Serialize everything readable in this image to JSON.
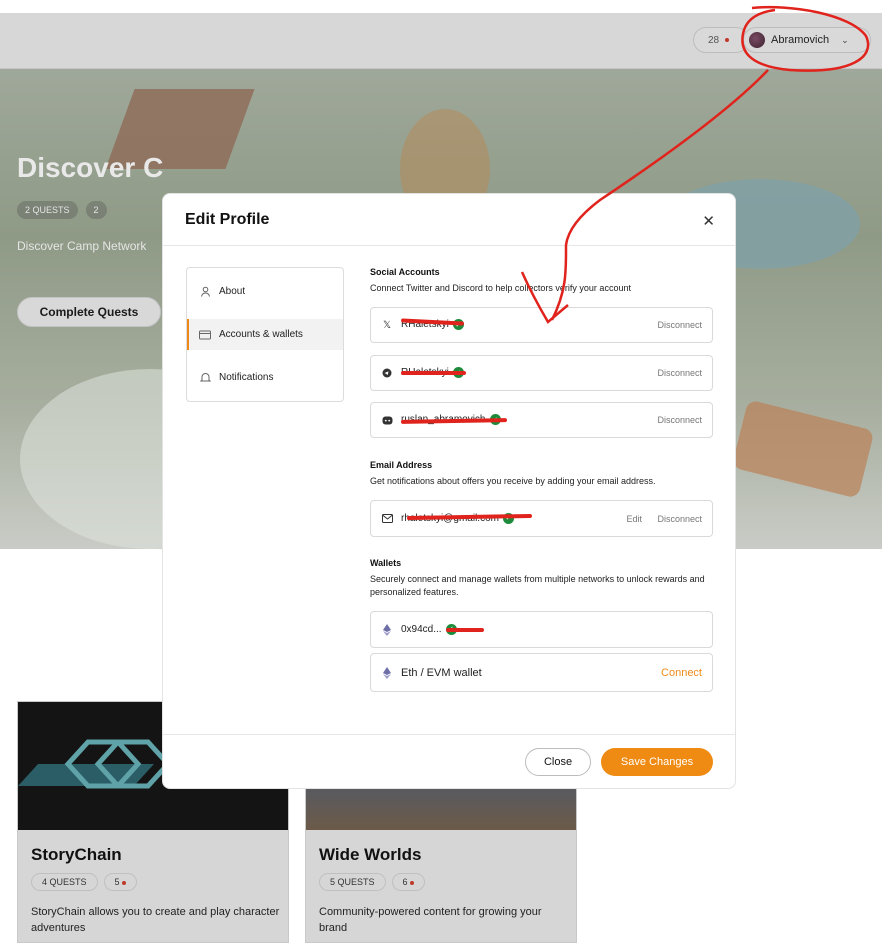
{
  "header": {
    "points": "28",
    "username": "Abramovich"
  },
  "hero": {
    "title": "Discover C",
    "badges": [
      "2 QUESTS",
      "2"
    ],
    "description": "Discover Camp Network",
    "cta": "Complete Quests"
  },
  "cards": [
    {
      "title": "StoryChain",
      "quests": "4 QUESTS",
      "points": "5",
      "description": "StoryChain allows you to create and play character adventures"
    },
    {
      "title": "Wide Worlds",
      "quests": "5 QUESTS",
      "points": "6",
      "description": "Community-powered content for growing your brand"
    }
  ],
  "modal": {
    "title": "Edit Profile",
    "sidebar": [
      {
        "label": "About",
        "icon": "user-icon"
      },
      {
        "label": "Accounts & wallets",
        "icon": "wallet-icon",
        "active": true
      },
      {
        "label": "Notifications",
        "icon": "bell-icon"
      }
    ],
    "social": {
      "title": "Social Accounts",
      "subtitle": "Connect Twitter and Discord to help collectors verify your account",
      "accounts": [
        {
          "icon": "x-icon",
          "value": "RHaletskyi",
          "action": "Disconnect"
        },
        {
          "icon": "telegram-icon",
          "value": "RHaletskyi",
          "action": "Disconnect"
        },
        {
          "icon": "discord-icon",
          "value": "ruslan_abramovich",
          "action": "Disconnect"
        }
      ]
    },
    "email": {
      "title": "Email Address",
      "subtitle": "Get notifications about offers you receive by adding your email address.",
      "value": "rhaletskyi@gmail.com",
      "edit": "Edit",
      "action": "Disconnect"
    },
    "wallets": {
      "title": "Wallets",
      "subtitle": "Securely connect and manage wallets from multiple networks to unlock rewards and personalized features.",
      "connected": "0x94cd...",
      "evm_label": "Eth / EVM wallet",
      "connect": "Connect"
    },
    "buttons": {
      "close": "Close",
      "save": "Save Changes"
    }
  },
  "colors": {
    "accent": "#ef8a12",
    "verified": "#1d8b3b",
    "annotation": "#e0231c"
  }
}
